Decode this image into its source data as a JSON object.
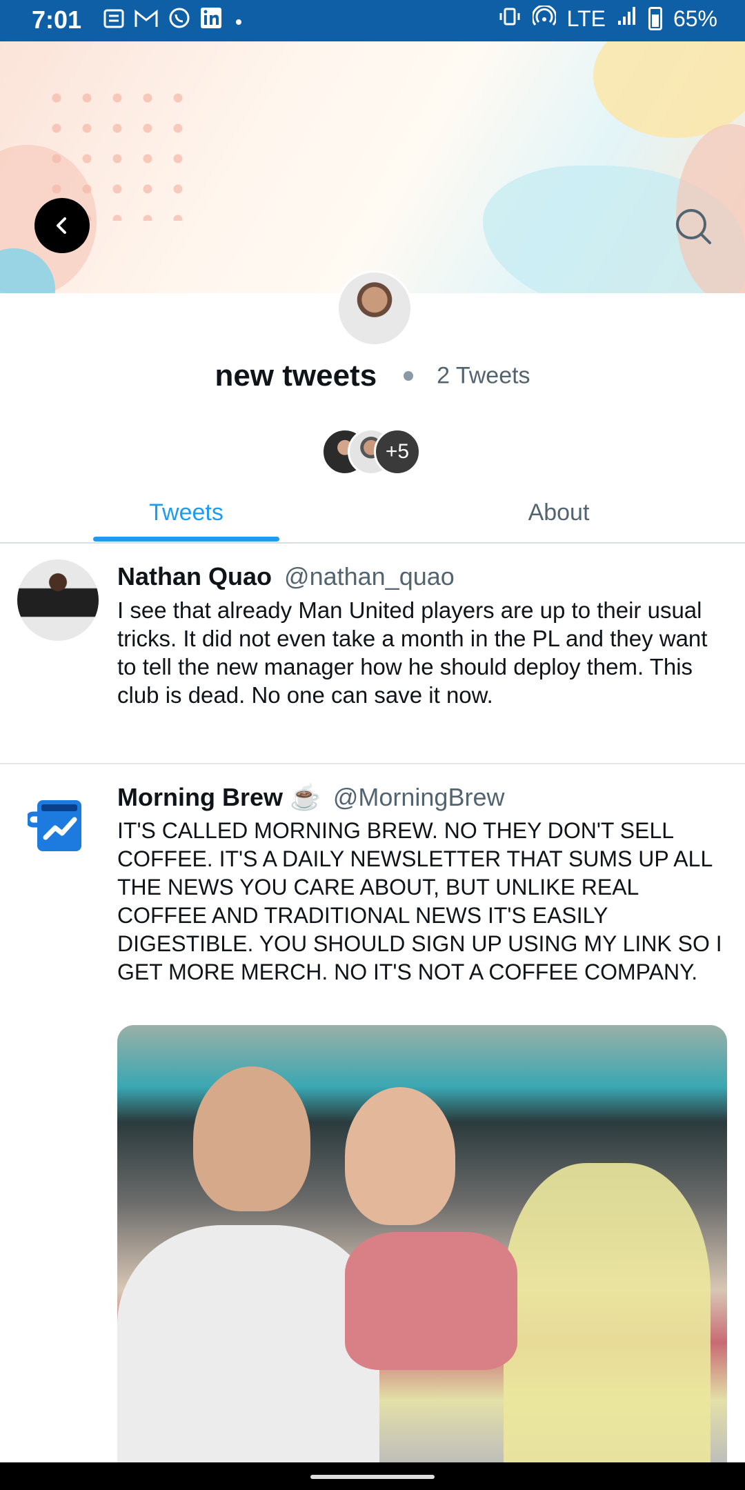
{
  "status_bar": {
    "time": "7:01",
    "network": "LTE",
    "battery": "65%",
    "notification_icons": [
      "message-icon",
      "gmail-icon",
      "whatsapp-icon",
      "linkedin-icon"
    ]
  },
  "header": {
    "back_icon": "chevron-left-icon",
    "search_icon": "search-icon"
  },
  "list": {
    "name": "new tweets",
    "tweet_count": "2 Tweets",
    "members_more": "+5"
  },
  "tabs": [
    {
      "label": "Tweets",
      "active": true
    },
    {
      "label": "About",
      "active": false
    }
  ],
  "tweets": [
    {
      "name": "Nathan Quao",
      "handle": "@nathan_quao",
      "text": "I see that already Man United players are up to their usual tricks. It did not even take a month in the PL and they want to tell the new manager how he should deploy them. This club is dead. No one can save it now."
    },
    {
      "name": "Morning Brew ☕",
      "handle": "@MorningBrew",
      "text": "IT'S CALLED MORNING BREW. NO THEY DON'T SELL COFFEE. IT'S A DAILY NEWSLETTER THAT SUMS UP ALL THE NEWS YOU CARE ABOUT, BUT UNLIKE REAL COFFEE AND TRADITIONAL NEWS IT'S EASILY DIGESTIBLE. YOU SHOULD SIGN UP USING MY LINK SO I GET MORE MERCH. NO IT'S NOT A COFFEE COMPANY."
    }
  ],
  "colors": {
    "accent": "#1d9bf0",
    "status_bar": "#0f5fa6",
    "secondary_text": "#536471"
  }
}
